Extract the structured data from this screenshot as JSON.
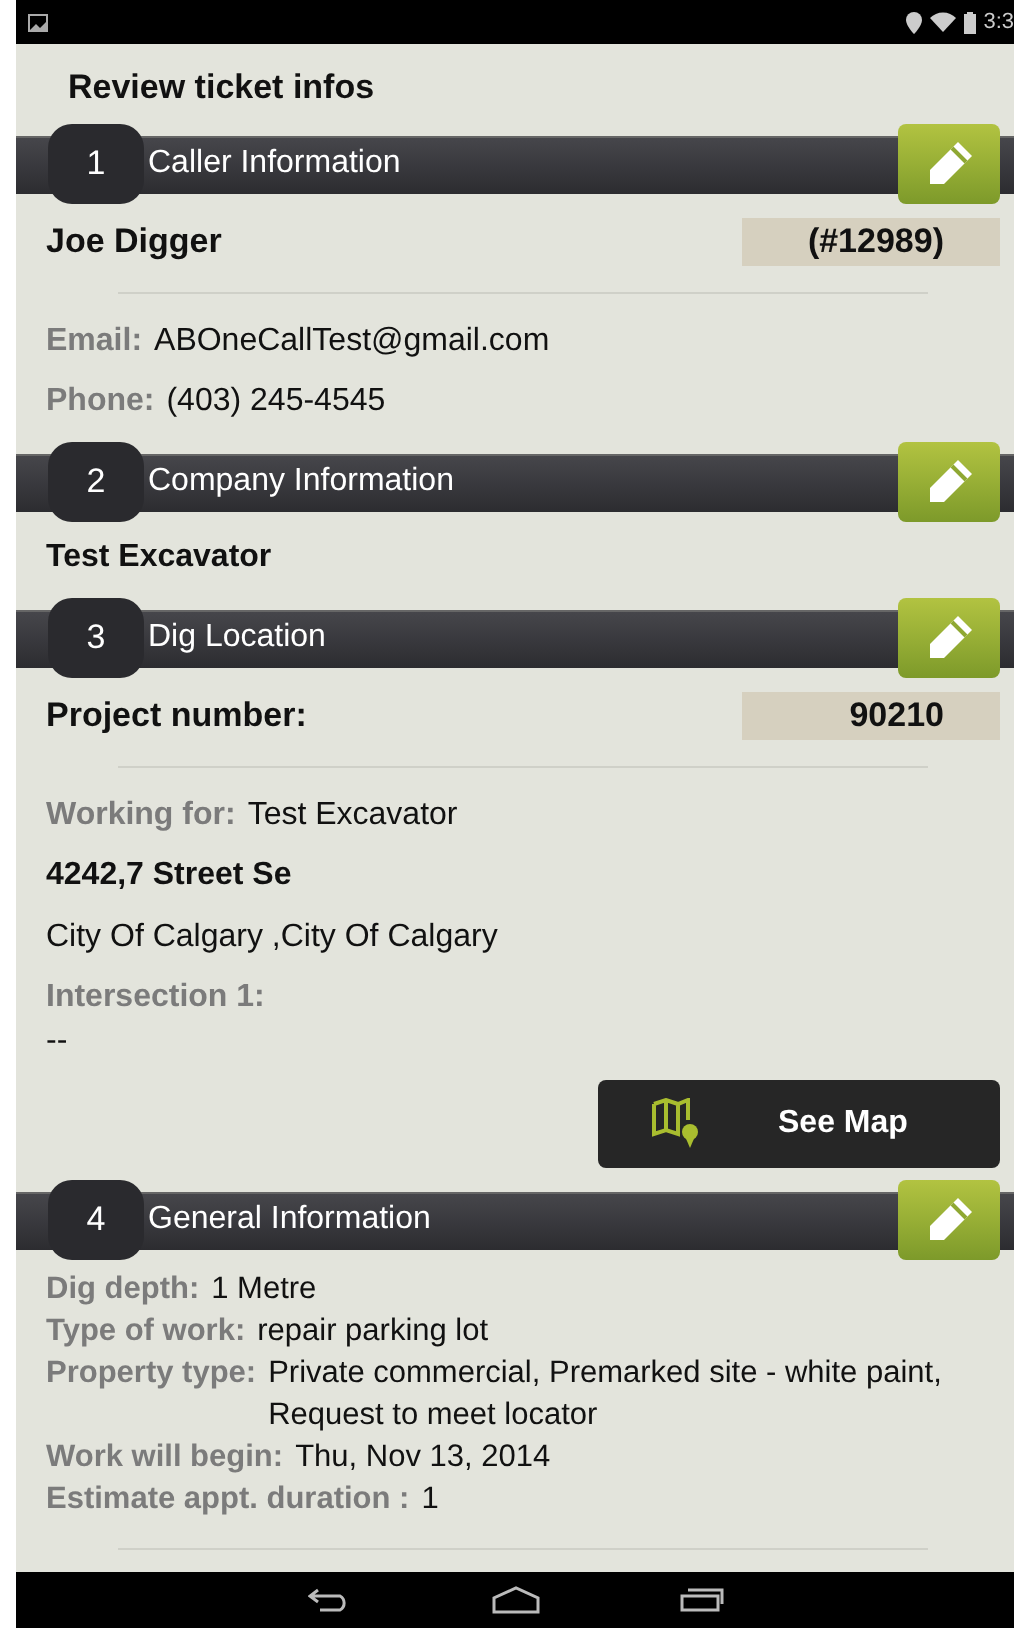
{
  "status_bar": {
    "time": "3:3"
  },
  "page_title": "Review ticket infos",
  "sections": [
    {
      "number": "1",
      "title": "Caller Information",
      "rows": [
        {
          "kind": "title_badge",
          "title": "Joe Digger",
          "badge": "(#12989)"
        },
        {
          "kind": "divider"
        },
        {
          "kind": "field",
          "label": "Email:",
          "value": "ABOneCallTest@gmail.com"
        },
        {
          "kind": "field",
          "label": "Phone:",
          "value": "(403) 245-4545"
        }
      ]
    },
    {
      "number": "2",
      "title": "Company Information",
      "rows": [
        {
          "kind": "bold",
          "text": "Test Excavator"
        }
      ]
    },
    {
      "number": "3",
      "title": "Dig Location",
      "rows": [
        {
          "kind": "title_badge",
          "title": "Project number:",
          "badge": "90210"
        },
        {
          "kind": "divider"
        },
        {
          "kind": "field",
          "label": "Working for:",
          "value": "Test Excavator"
        },
        {
          "kind": "bold",
          "text": "4242,7 Street Se"
        },
        {
          "kind": "text",
          "text": "City Of Calgary ,City Of Calgary"
        },
        {
          "kind": "label",
          "text": "Intersection 1:"
        },
        {
          "kind": "text",
          "text": "--"
        },
        {
          "kind": "button",
          "text": "See Map"
        }
      ]
    },
    {
      "number": "4",
      "title": "General Information",
      "rows": [
        {
          "kind": "compact_field",
          "label": "Dig depth:",
          "value": "1 Metre"
        },
        {
          "kind": "compact_field",
          "label": "Type of work:",
          "value": "repair parking lot"
        },
        {
          "kind": "compact_field",
          "label": "Property type:",
          "value": "Private commercial, Premarked site - white paint, Request to meet locator"
        },
        {
          "kind": "compact_field",
          "label": "Work will begin:",
          "value": "Thu, Nov 13, 2014"
        },
        {
          "kind": "compact_field",
          "label": "Estimate appt. duration :",
          "value": "1"
        },
        {
          "kind": "divider"
        }
      ]
    }
  ]
}
